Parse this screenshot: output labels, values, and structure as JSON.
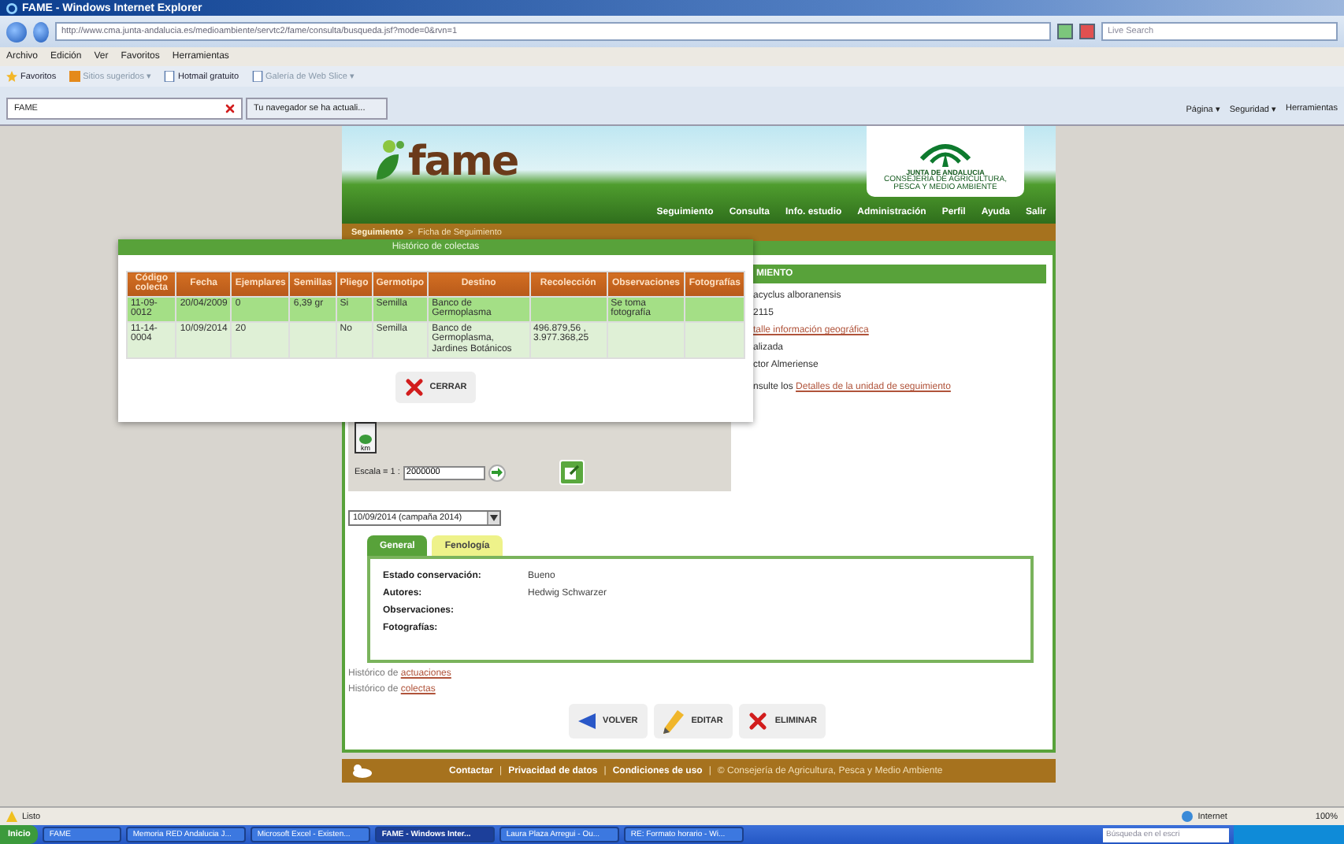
{
  "browser": {
    "title": "FAME - Windows Internet Explorer",
    "url": "http://www.cma.junta-andalucia.es/medioambiente/servtc2/fame/consulta/busqueda.jsf?mode=0&rvn=1",
    "search_placeholder": "Live Search",
    "menu": [
      "Archivo",
      "Edición",
      "Ver",
      "Favoritos",
      "Herramientas"
    ],
    "favorites": [
      {
        "label": "Favoritos",
        "kind": "star"
      },
      {
        "label": "Sitios sugeridos ▾",
        "kind": "feed"
      },
      {
        "label": "Hotmail gratuito",
        "kind": "page"
      },
      {
        "label": "Galería de Web Slice ▾",
        "kind": "page"
      }
    ],
    "tabs": [
      {
        "label": "FAME",
        "selected": true
      },
      {
        "label": "Tu navegador se ha actuali...",
        "selected": false
      }
    ],
    "commands": [
      "Página ▾",
      "Seguridad ▾",
      "Herramientas"
    ]
  },
  "page": {
    "logo_text": "fame",
    "org_logo": {
      "title": "JUNTA DE ANDALUCIA",
      "subtitle": "CONSEJERÍA DE AGRICULTURA, PESCA Y MEDIO AMBIENTE"
    },
    "nav": [
      "Seguimiento",
      "Consulta",
      "Info. estudio",
      "Administración",
      "Perfil",
      "Ayuda",
      "Salir"
    ],
    "breadcrumb": {
      "link": "Seguimiento",
      "separator": ">",
      "current": "Ficha de Seguimiento"
    },
    "panel_header": "MIENTO",
    "details": [
      {
        "text": "acyclus alboranensis",
        "kind": "text"
      },
      {
        "text": "2115",
        "kind": "text"
      },
      {
        "text": "talle información geográfica",
        "kind": "link"
      },
      {
        "text": "alizada",
        "kind": "text"
      },
      {
        "text": "ctor Almeriense",
        "kind": "text"
      }
    ],
    "units_line": {
      "prefix": "nsulte los",
      "link": "Detalles de la unidad de seguimiento"
    },
    "map": {
      "unit": "km",
      "scale_label": "Escala = 1 :",
      "scale_value": "2000000"
    },
    "campaign": "10/09/2014 (campaña 2014)",
    "tabs": [
      {
        "label": "General",
        "selected": true
      },
      {
        "label": "Fenología",
        "selected": false
      }
    ],
    "fields": [
      {
        "label": "Estado conservación:",
        "value": "Bueno"
      },
      {
        "label": "Autores:",
        "value": "Hedwig Schwarzer"
      },
      {
        "label": "Observaciones:"
      },
      {
        "label": "Fotografías:"
      }
    ],
    "history_links": [
      {
        "prefix": "Histórico de",
        "link": "actuaciones"
      },
      {
        "prefix": "Histórico de",
        "link": "colectas"
      }
    ],
    "buttons": [
      {
        "label": "VOLVER",
        "kind": "back"
      },
      {
        "label": "EDITAR",
        "kind": "edit"
      },
      {
        "label": "ELIMINAR",
        "kind": "delete"
      }
    ],
    "footer": {
      "separator": "|",
      "links": [
        "Contactar",
        "Privacidad de datos",
        "Condiciones de uso"
      ],
      "copyright": "© Consejería de Agricultura, Pesca y Medio Ambiente"
    }
  },
  "modal": {
    "title": "Histórico de colectas",
    "columns": [
      "Código colecta",
      "Fecha",
      "Ejemplares",
      "Semillas",
      "Pliego",
      "Germotipo",
      "Destino",
      "Recolección",
      "Observaciones",
      "Fotografías"
    ],
    "rows": [
      [
        "11-09-0012",
        "20/04/2009",
        "0",
        "6,39 gr",
        "Si",
        "Semilla",
        "Banco de Germoplasma",
        "",
        "Se toma fotografía",
        ""
      ],
      [
        "11-14-0004",
        "10/09/2014",
        "20",
        "",
        "No",
        "Semilla",
        "Banco de Germoplasma, Jardines Botánicos",
        "496.879,56 , 3.977.368,25",
        "",
        ""
      ]
    ],
    "close_label": "CERRAR"
  },
  "status_bar": {
    "text": "Listo",
    "zone": "Internet",
    "zoom": "100%"
  },
  "taskbar": {
    "start": "Inicio",
    "items": [
      {
        "label": "FAME",
        "selected": false
      },
      {
        "label": "Memoria RED Andalucia J...",
        "selected": false
      },
      {
        "label": "Microsoft Excel - Existen...",
        "selected": false
      },
      {
        "label": "FAME - Windows Inter...",
        "selected": true
      },
      {
        "label": "Laura Plaza Arregui - Ou...",
        "selected": false
      },
      {
        "label": "RE: Formato horario - Wi...",
        "selected": false
      }
    ],
    "search_placeholder": "Búsqueda en el escri"
  }
}
